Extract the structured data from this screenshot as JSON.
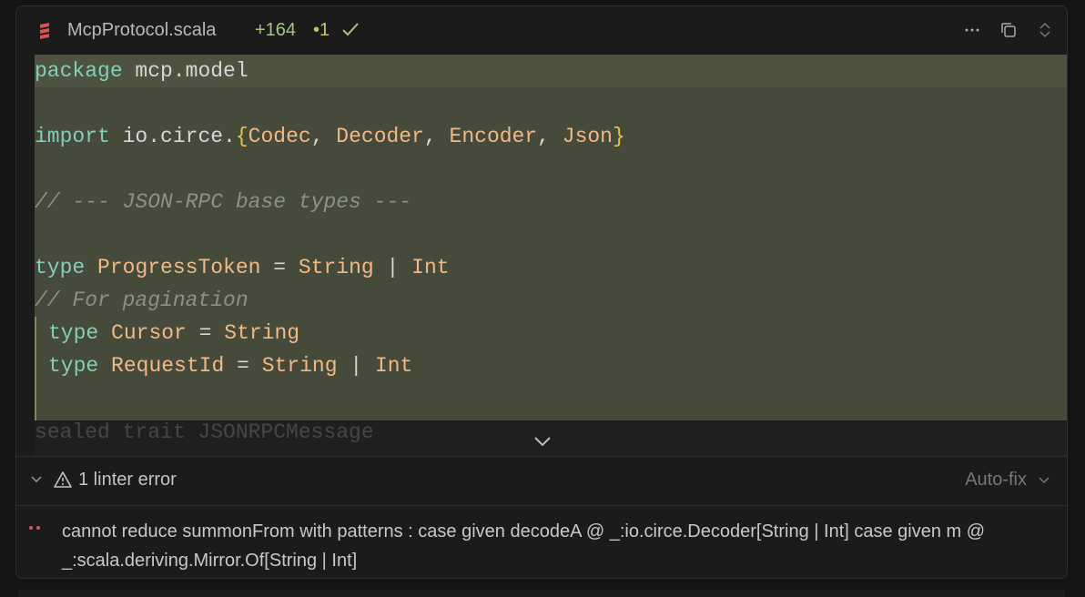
{
  "header": {
    "filename": "McpProtocol.scala",
    "added": "+164",
    "removed": "•1",
    "icons": [
      "scala-file-icon",
      "check-icon",
      "more-icon",
      "copy-icon",
      "expand-collapse-icon"
    ]
  },
  "code": {
    "line1": {
      "kw": "package",
      "rest": " mcp.model"
    },
    "line3": {
      "kw": "import",
      "pre": " io.circe.",
      "open": "{",
      "t1": "Codec",
      "s1": ", ",
      "t2": "Decoder",
      "s2": ", ",
      "t3": "Encoder",
      "s3": ", ",
      "t4": "Json",
      "close": "}"
    },
    "line5": "// --- JSON-RPC base types ---",
    "line7": {
      "kw": "type",
      "name": "ProgressToken",
      "eq": " = ",
      "t1": "String",
      "bar": " | ",
      "t2": "Int"
    },
    "line8": "// For pagination",
    "line9": {
      "kw": "type",
      "name": "Cursor",
      "eq": " = ",
      "t1": "String"
    },
    "line10": {
      "kw": "type",
      "name": "RequestId",
      "eq": " = ",
      "t1": "String",
      "bar": " | ",
      "t2": "Int"
    },
    "faded": "sealed trait JSONRPCMessage"
  },
  "linter": {
    "summary": "1 linter error",
    "autofix": "Auto-fix",
    "error_message": "cannot reduce summonFrom with patterns : case given decodeA @ _:io.circe.Decoder[String | Int] case given m @ _:scala.deriving.Mirror.Of[String | Int]"
  },
  "colors": {
    "background": "#1b1b1b",
    "diff_added_bg": "#454a3a",
    "keyword": "#83cfb7",
    "type": "#f0b986",
    "added": "#a3c586"
  }
}
